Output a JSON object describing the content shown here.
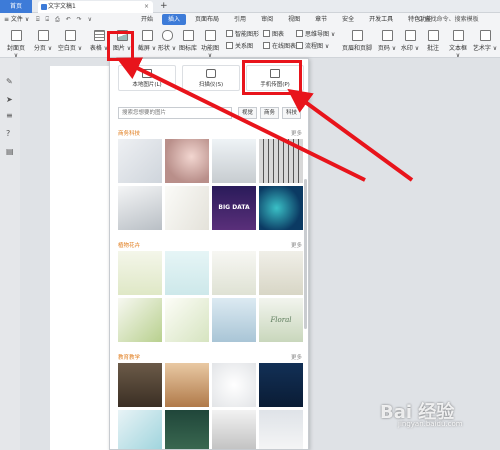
{
  "titlebar": {
    "home_tab": "首页",
    "doc_tab": "文字文稿1",
    "close_glyph": "×",
    "new_tab_glyph": "+"
  },
  "menubar": {
    "file_label": "≡ 文件 ∨",
    "quick_glyphs": "⌸ ⌹ ⎙ ↶ ↷ ∨",
    "tabs": [
      "开始",
      "插入",
      "页面布局",
      "引用",
      "审阅",
      "视图",
      "章节",
      "安全",
      "开发工具",
      "特色功能"
    ],
    "active_tab": "插入",
    "search_label": "Q 查找命令、搜索模板"
  },
  "ribbon": {
    "cover": "封面页 ∨",
    "pagination": "分页 ∨",
    "blank_page": "空白页 ∨",
    "table": "表格 ∨",
    "picture": "图片 ∨",
    "screenshot": "截屏 ∨",
    "shape": "形状 ∨",
    "icon_lib": "图标库",
    "function_chart": "功能图 ∨",
    "smart_graphic": "智能图形",
    "chart": "图表",
    "relation": "关系图",
    "online_chart": "在线图表",
    "mind_map": "思维导图 ∨",
    "flow_chart": "流程图 ∨",
    "header_footer": "页眉和页脚",
    "page_number": "页码 ∨",
    "watermark": "水印 ∨",
    "comment": "批注",
    "text_box": "文本框 ∨",
    "art_text": "艺术字 ∨"
  },
  "panel": {
    "local_image": "本地图片(L)",
    "scanner": "扫描仪(S)",
    "phone_image": "手机传图(P)",
    "search_placeholder": "搜索您想要的图片",
    "chips": [
      "视觉",
      "商务",
      "科技"
    ],
    "categories": [
      {
        "title": "商务科技",
        "more": "更多"
      },
      {
        "title": "植物花卉",
        "more": "更多"
      },
      {
        "title": "教育教学",
        "more": "更多"
      }
    ],
    "thumb_texts": {
      "big_data": "BIG DATA",
      "floral": "Floral"
    }
  },
  "watermark": {
    "brand": "Bai 经验",
    "sub": "jingyan.baidu.com"
  },
  "colors": {
    "accent": "#3d7bd8",
    "annotation_red": "#e8141b",
    "category_orange": "#e07b1a"
  }
}
